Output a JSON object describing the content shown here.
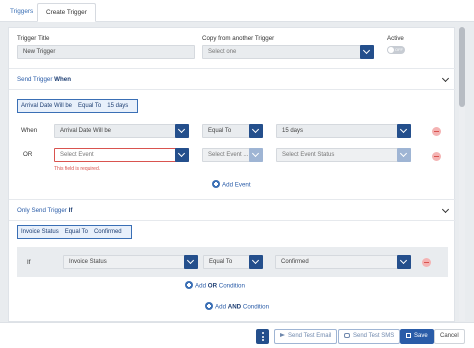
{
  "tabs": [
    {
      "label": "Triggers",
      "active": false
    },
    {
      "label": "Create Trigger",
      "active": true
    }
  ],
  "general": {
    "title_label": "Trigger Title",
    "title_value": "New Trigger",
    "copy_label": "Copy from another Trigger",
    "copy_placeholder": "Select one",
    "active_label": "Active",
    "active_toggle_text": "OFF",
    "active_state": false
  },
  "send_when": {
    "title_prefix": "Send Trigger",
    "title_bold": "When",
    "summary": [
      "Arrival Date Will be",
      "Equal To",
      "15 days"
    ],
    "rows": [
      {
        "label": "When",
        "event": "Arrival Date Will be",
        "operator": "Equal To",
        "value": "15 days"
      },
      {
        "label": "OR",
        "event": "Select Event",
        "operator": "Select Event ...",
        "value": "Select Event Status",
        "error": "This field is required."
      }
    ],
    "add_event": "Add Event"
  },
  "send_if": {
    "title_prefix": "Only Send Trigger",
    "title_bold": "If",
    "summary": [
      "Invoice Status",
      "Equal To",
      "Confirmed"
    ],
    "row": {
      "label": "If",
      "field": "Invoice Status",
      "operator": "Equal To",
      "value": "Confirmed"
    },
    "add_or_prefix": "Add",
    "add_or_bold": "OR",
    "add_or_suffix": "Condition",
    "add_and_prefix": "Add",
    "add_and_bold": "AND",
    "add_and_suffix": "Condition"
  },
  "footer": {
    "send_email": "Send Test Email",
    "send_sms": "Send Test SMS",
    "save": "Save",
    "cancel": "Cancel"
  },
  "colors": {
    "accent": "#2a5ca8",
    "dark_accent": "#244f8c",
    "error": "#d9534f"
  }
}
